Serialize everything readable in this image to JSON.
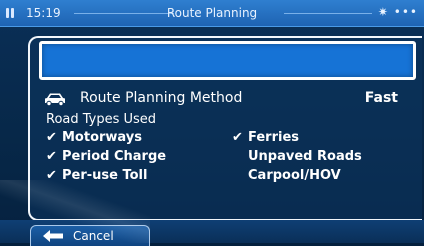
{
  "status": {
    "time": "15:19",
    "title": "Route Planning",
    "right_icons": "✷ •••"
  },
  "search": {
    "value": ""
  },
  "method": {
    "label": "Route Planning Method",
    "value": "Fast",
    "icon": "car-icon"
  },
  "road_types": {
    "label": "Road Types Used",
    "items": [
      {
        "label": "Motorways",
        "checked": true
      },
      {
        "label": "Ferries",
        "checked": true
      },
      {
        "label": "Period Charge",
        "checked": true
      },
      {
        "label": "Unpaved Roads",
        "checked": false
      },
      {
        "label": "Per-use Toll",
        "checked": true
      },
      {
        "label": "Carpool/HOV",
        "checked": false
      }
    ]
  },
  "footer": {
    "cancel_label": "Cancel"
  },
  "colors": {
    "background": "#04203e",
    "statusbar": "#1e63b2",
    "input": "#1673d6",
    "text": "#ffffff"
  }
}
